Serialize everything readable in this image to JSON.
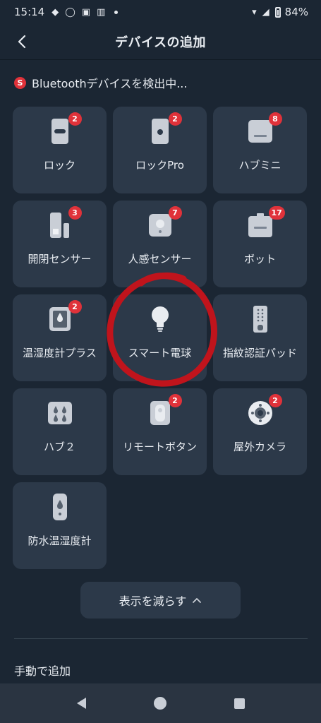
{
  "status": {
    "time": "15:14",
    "battery": "84%"
  },
  "header": {
    "title": "デバイスの追加"
  },
  "scan": {
    "icon_letter": "S",
    "text": "Bluetoothデバイスを検出中..."
  },
  "devices": [
    {
      "label": "ロック",
      "badge": "2",
      "icon": "lock-icon"
    },
    {
      "label": "ロックPro",
      "badge": "2",
      "icon": "lock-pro-icon"
    },
    {
      "label": "ハブミニ",
      "badge": "8",
      "icon": "hub-mini-icon"
    },
    {
      "label": "開閉センサー",
      "badge": "3",
      "icon": "contact-sensor-icon"
    },
    {
      "label": "人感センサー",
      "badge": "7",
      "icon": "motion-sensor-icon"
    },
    {
      "label": "ボット",
      "badge": "17",
      "icon": "bot-icon"
    },
    {
      "label": "温湿度計プラス",
      "badge": "2",
      "icon": "thermo-hygrometer-plus-icon"
    },
    {
      "label": "スマート電球",
      "badge": "",
      "icon": "light-bulb-icon"
    },
    {
      "label": "指紋認証パッド",
      "badge": "",
      "icon": "keypad-touch-icon"
    },
    {
      "label": "ハブ２",
      "badge": "",
      "icon": "hub-2-icon"
    },
    {
      "label": "リモートボタン",
      "badge": "2",
      "icon": "remote-button-icon"
    },
    {
      "label": "屋外カメラ",
      "badge": "2",
      "icon": "outdoor-camera-icon"
    },
    {
      "label": "防水温湿度計",
      "badge": "",
      "icon": "waterproof-thermometer-icon"
    }
  ],
  "show_less": {
    "label": "表示を減らす",
    "icon": "chevron-up-icon"
  },
  "manual_add": {
    "label": "手動で追加"
  },
  "annotation": {
    "color": "#c0141c",
    "target": "スマート電球"
  }
}
